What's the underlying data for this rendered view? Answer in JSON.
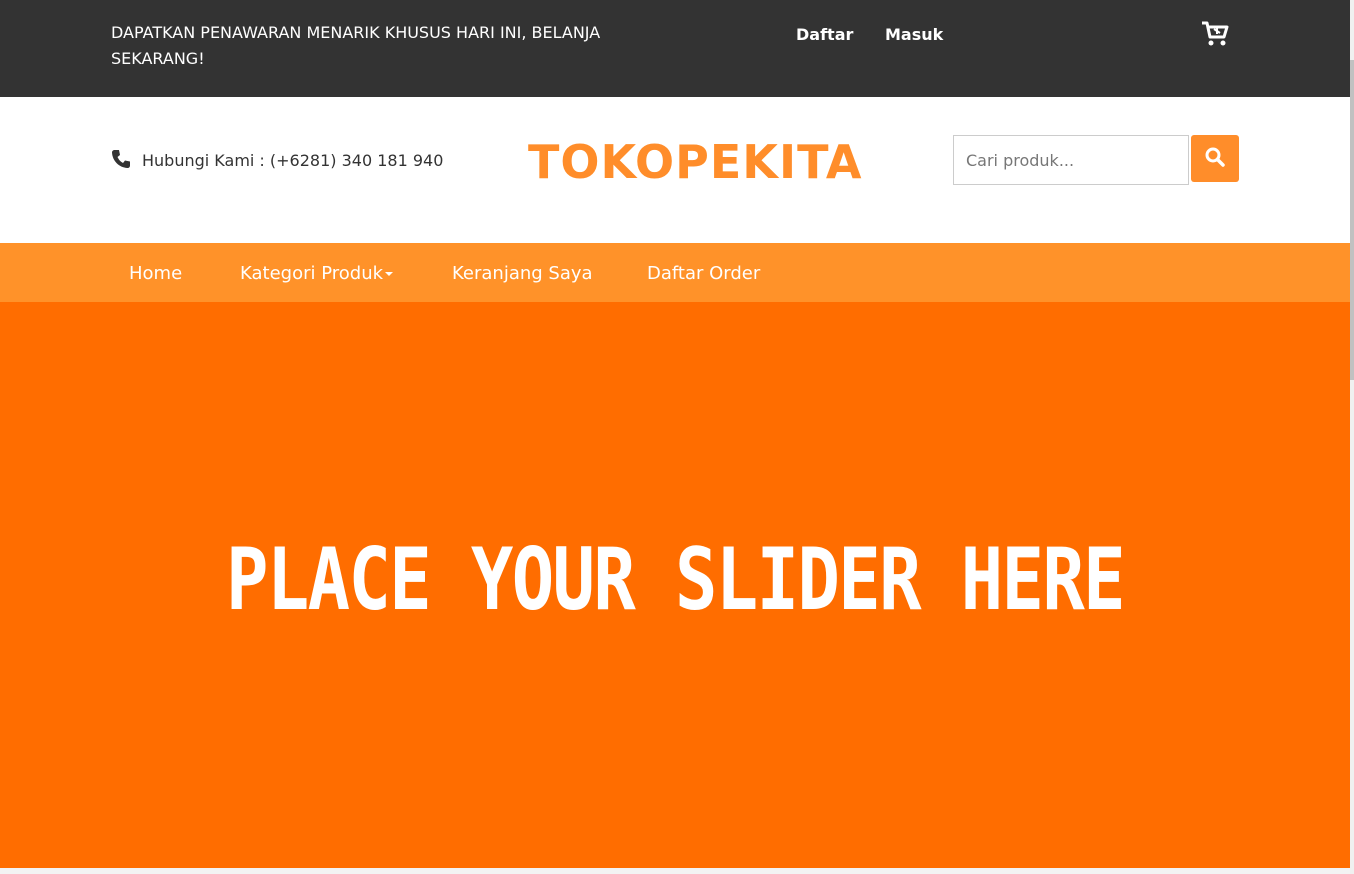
{
  "topbar": {
    "promo": "DAPATKAN PENAWARAN MENARIK KHUSUS HARI INI, BELANJA SEKARANG!",
    "register": "Daftar",
    "login": "Masuk",
    "cart_icon": "cart-icon"
  },
  "header": {
    "contact": "Hubungi Kami : (+6281) 340 181 940",
    "brand": "TOKOPEKITA",
    "search_placeholder": "Cari produk...",
    "phone_icon": "phone-icon",
    "search_icon": "search-icon"
  },
  "nav": {
    "home": "Home",
    "category": "Kategori Produk",
    "cart": "Keranjang Saya",
    "orders": "Daftar Order"
  },
  "slider": {
    "text": "PLACE YOUR SLIDER HERE"
  },
  "colors": {
    "topbar": "#333333",
    "brand": "#ff8d2a",
    "navbar": "#ff9229",
    "slider": "#ff6d00"
  }
}
